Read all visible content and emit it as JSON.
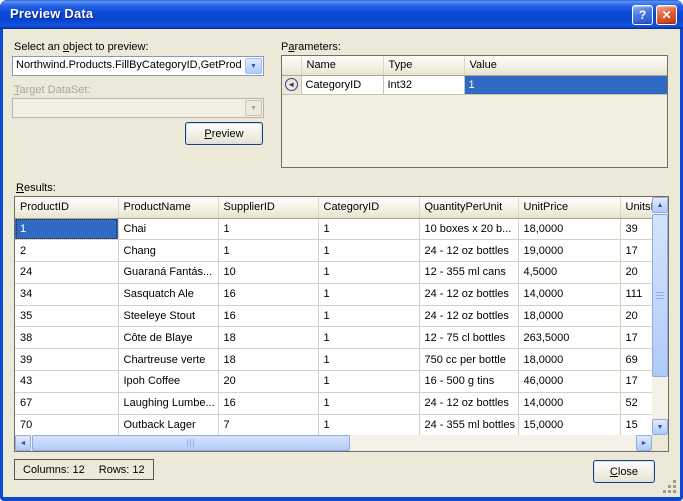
{
  "titlebar": {
    "title": "Preview Data"
  },
  "icons": {
    "help_glyph": "?",
    "close_glyph": "✕",
    "dropdown_glyph": "▼",
    "row_indicator_glyph": "◄",
    "scroll_up_glyph": "▲",
    "scroll_down_glyph": "▼",
    "scroll_left_glyph": "◄",
    "scroll_right_glyph": "►"
  },
  "colors": {
    "selection_blue": "#316AC5",
    "dialog_background": "#ECE9D8",
    "titlebar_blue": "#0B49D0"
  },
  "object_selector": {
    "label": {
      "pre": "Select an ",
      "accel": "o",
      "post": "bject to preview:"
    },
    "value": "Northwind.Products.FillByCategoryID,GetProd"
  },
  "target_dataset": {
    "label": {
      "accel": "T",
      "post": "arget DataSet:"
    },
    "value": ""
  },
  "preview_button": {
    "accel": "P",
    "post": "review"
  },
  "parameters": {
    "label": {
      "pre": "P",
      "accel": "a",
      "post": "rameters:"
    },
    "columns": [
      "Name",
      "Type",
      "Value"
    ],
    "row": {
      "name": "CategoryID",
      "type": "Int32",
      "value": "1"
    }
  },
  "results": {
    "label": {
      "accel": "R",
      "post": "esults:"
    },
    "columns": [
      "ProductID",
      "ProductName",
      "SupplierID",
      "CategoryID",
      "QuantityPerUnit",
      "UnitPrice",
      "UnitsI"
    ],
    "rows": [
      [
        "1",
        "Chai",
        "1",
        "1",
        "10 boxes x 20 b...",
        "18,0000",
        "39"
      ],
      [
        "2",
        "Chang",
        "1",
        "1",
        "24 - 12 oz bottles",
        "19,0000",
        "17"
      ],
      [
        "24",
        "Guaraná Fantás...",
        "10",
        "1",
        "12 - 355 ml cans",
        "4,5000",
        "20"
      ],
      [
        "34",
        "Sasquatch Ale",
        "16",
        "1",
        "24 - 12 oz bottles",
        "14,0000",
        "111"
      ],
      [
        "35",
        "Steeleye Stout",
        "16",
        "1",
        "24 - 12 oz bottles",
        "18,0000",
        "20"
      ],
      [
        "38",
        "Côte de Blaye",
        "18",
        "1",
        "12 - 75 cl bottles",
        "263,5000",
        "17"
      ],
      [
        "39",
        "Chartreuse verte",
        "18",
        "1",
        "750 cc per bottle",
        "18,0000",
        "69"
      ],
      [
        "43",
        "Ipoh Coffee",
        "20",
        "1",
        "16 - 500 g tins",
        "46,0000",
        "17"
      ],
      [
        "67",
        "Laughing Lumbe...",
        "16",
        "1",
        "24 - 12 oz bottles",
        "14,0000",
        "52"
      ],
      [
        "70",
        "Outback Lager",
        "7",
        "1",
        "24 - 355 ml bottles",
        "15,0000",
        "15"
      ]
    ]
  },
  "status": {
    "columns_count": "Columns: 12",
    "rows_count": "Rows: 12"
  },
  "close_button": {
    "accel": "C",
    "post": "lose"
  }
}
